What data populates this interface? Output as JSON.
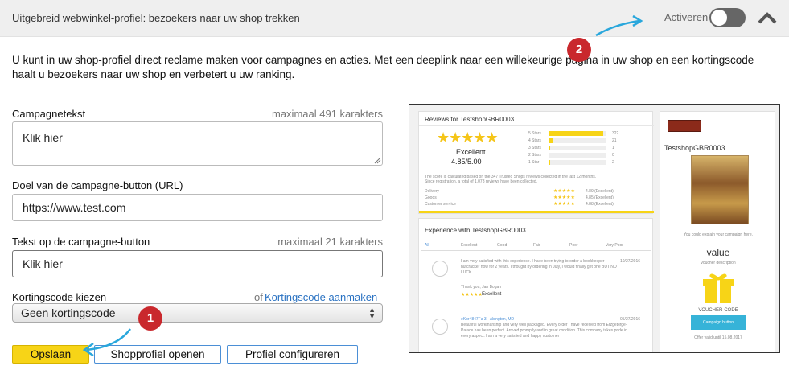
{
  "header": {
    "title": "Uitgebreid webwinkel-profiel: bezoekers naar uw shop trekken",
    "activate_label": "Activeren"
  },
  "intro": "U kunt in uw shop-profiel direct reclame maken voor campagnes en acties. Met een deeplink naar een willekeurige pagina in uw shop en een kortingscode haalt u bezoekers naar uw shop en verbetert u uw ranking.",
  "form": {
    "campaign_text": {
      "label": "Campagnetekst",
      "hint": "maximaal 491 karakters",
      "value": "Klik hier"
    },
    "button_url": {
      "label": "Doel van de campagne-button (URL)",
      "value": "https://www.test.com"
    },
    "button_text": {
      "label": "Tekst op de campagne-button",
      "hint": "maximaal 21 karakters",
      "value": "Klik hier"
    },
    "discount": {
      "label": "Kortingscode kiezen",
      "or_text": "of",
      "create_link": "Kortingscode aanmaken",
      "selected": "Geen kortingscode"
    }
  },
  "buttons": {
    "save": "Opslaan",
    "open_profile": "Shopprofiel openen",
    "configure": "Profiel configureren"
  },
  "badges": {
    "one": "1",
    "two": "2"
  },
  "preview": {
    "reviews_title": "Reviews for TestshopGBR0003",
    "rating_word": "Excellent",
    "rating_score": "4.85/5.00",
    "rating_rows": [
      {
        "label": "5 Stars",
        "count": "322",
        "fill": 0.95
      },
      {
        "label": "4 Stars",
        "count": "21",
        "fill": 0.07
      },
      {
        "label": "3 Stars",
        "count": "1",
        "fill": 0.01
      },
      {
        "label": "2 Stars",
        "count": "0",
        "fill": 0.0
      },
      {
        "label": "1 Star",
        "count": "2",
        "fill": 0.01
      }
    ],
    "criteria": [
      {
        "label": "Delivery",
        "score": "4.89 (Excellent)"
      },
      {
        "label": "Goods",
        "score": "4.85 (Excellent)"
      },
      {
        "label": "Customer service",
        "score": "4.88 (Excellent)"
      }
    ],
    "experience_title": "Experience with TestshopGBR0003",
    "tabs": [
      "All",
      "Excellent",
      "Good",
      "Fair",
      "Poor",
      "Very Poor"
    ],
    "review1": {
      "text": "I am very satisfied with this experience. I have been trying to order a bookkeeper nutcracker now for 2 years. I thought by ordering in July, I would finally get one BUT NO LUCK",
      "author": "Thank you, Jan Bogan",
      "date": "10/27/2016",
      "rating": "Excellent"
    },
    "review2": {
      "author": "eKor4847Fa 3 - Abington, MD",
      "text": "Beautiful workmanship and very well packaged. Every order I have received from Erzgebirge-Palace has been perfect. Arrived promptly and in great condition. This company takes pride in every aspect. I am a very satisfied and happy customer",
      "date": "05/27/2016"
    },
    "shop_name": "TestshopGBR0003",
    "explain": "You could explain your campaign here.",
    "voucher_value": "value",
    "voucher_desc": "voucher description",
    "voucher_code": "VOUCHER-CODE",
    "campaign_button": "Campaign button",
    "offer_valid": "Offer valid until 15.08.2017"
  },
  "colors": {
    "accent_yellow": "#f7d417",
    "badge_red": "#c9282d",
    "arrow_blue": "#29a7dc",
    "link_blue": "#2a72c2"
  }
}
